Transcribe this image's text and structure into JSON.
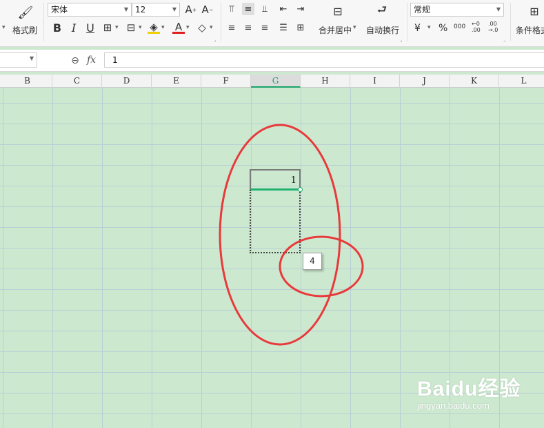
{
  "ribbon": {
    "format_painter_label": "格式刷",
    "font_name": "宋体",
    "font_size": "12",
    "merge_center_label": "合并居中",
    "wrap_text_label": "自动换行",
    "number_format": "常规",
    "conditional_format_label": "条件格式",
    "currency_symbol": "¥",
    "percent_symbol": "%",
    "thousands_symbol": "000",
    "increase_decimal": "←0 .00",
    "decrease_decimal": ".00 →.0",
    "bold": "B",
    "italic": "I",
    "underline": "U",
    "font_color_glyph": "A"
  },
  "formula_bar": {
    "fx_label": "fx",
    "value": "1"
  },
  "columns": [
    "B",
    "C",
    "D",
    "E",
    "F",
    "G",
    "H",
    "I",
    "J",
    "K",
    "L"
  ],
  "active_column": "G",
  "cell": {
    "value": "1"
  },
  "fill_tooltip": "4",
  "watermark": {
    "brand": "Baidu经验",
    "url": "jingyan.baidu.com"
  },
  "colors": {
    "grid_background": "#cce8cf",
    "selection_accent": "#20b070",
    "annotation_red": "#e8393b"
  }
}
